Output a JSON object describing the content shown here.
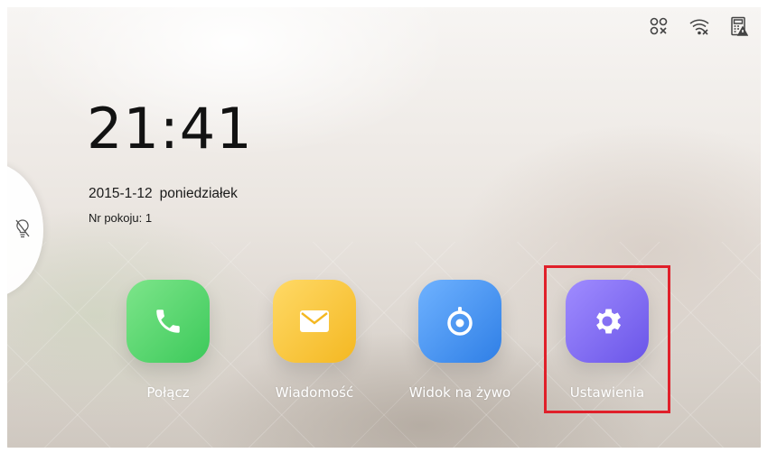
{
  "status_icons": [
    "network-disconnected-icon",
    "wifi-off-icon",
    "device-warning-icon"
  ],
  "clock": {
    "time": "21:41"
  },
  "date": {
    "date": "2015-1-12",
    "weekday": "poniedziałek"
  },
  "room": {
    "label": "Nr pokoju: 1"
  },
  "side_tab": {
    "icon": "lightbulb-off-icon"
  },
  "apps": [
    {
      "label": "Połącz",
      "icon": "phone-icon",
      "color": "#4cd964"
    },
    {
      "label": "Wiadomość",
      "icon": "envelope-icon",
      "color": "#f6c137"
    },
    {
      "label": "Widok na żywo",
      "icon": "camera-lens-icon",
      "color": "#3d8bf0"
    },
    {
      "label": "Ustawienia",
      "icon": "gear-icon",
      "color": "#7a63f0"
    }
  ],
  "highlight": {
    "target": "Ustawienia",
    "color": "#e0202a"
  }
}
